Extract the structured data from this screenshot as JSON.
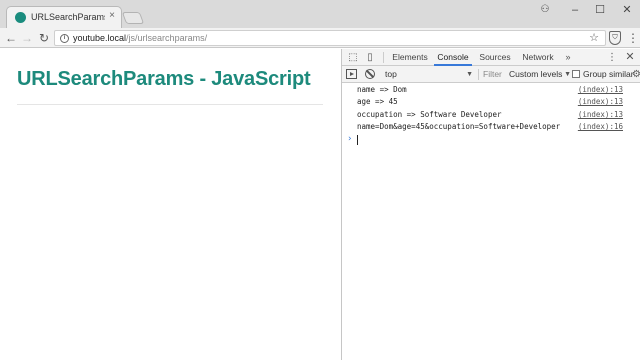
{
  "browser": {
    "tab": {
      "title": "URLSearchParams - JavaSc",
      "close": "×"
    },
    "window": {
      "user": "⚇",
      "minimize": "–",
      "maximize": "☐",
      "close": "✕"
    },
    "toolbar": {
      "back": "←",
      "forward": "→",
      "reload": "↻",
      "info": "i",
      "url_host": "youtube.local",
      "url_path": "/js/urlsearchparams/",
      "star": "☆",
      "extension": "⛉",
      "menu": "⋮"
    }
  },
  "page": {
    "title": "URLSearchParams - JavaScript"
  },
  "devtools": {
    "icons": {
      "inspect": "⬚",
      "device": "▯",
      "more": "»",
      "kebab": "⋮",
      "close": "✕",
      "gear": "⚙"
    },
    "tabs": [
      {
        "label": "Elements"
      },
      {
        "label": "Console"
      },
      {
        "label": "Sources"
      },
      {
        "label": "Network"
      }
    ],
    "filterbar": {
      "context": "top",
      "dropdown_arrow": "▼",
      "filter_placeholder": "Filter",
      "levels": "Custom levels",
      "group_similar": "Group similar"
    },
    "console": {
      "lines": [
        {
          "text": "name => Dom",
          "source": "(index):13"
        },
        {
          "text": "age => 45",
          "source": "(index):13"
        },
        {
          "text": "occupation => Software Developer",
          "source": "(index):13"
        },
        {
          "text": "name=Dom&age=45&occupation=Software+Developer",
          "source": "(index):16"
        }
      ],
      "prompt": "›"
    }
  }
}
